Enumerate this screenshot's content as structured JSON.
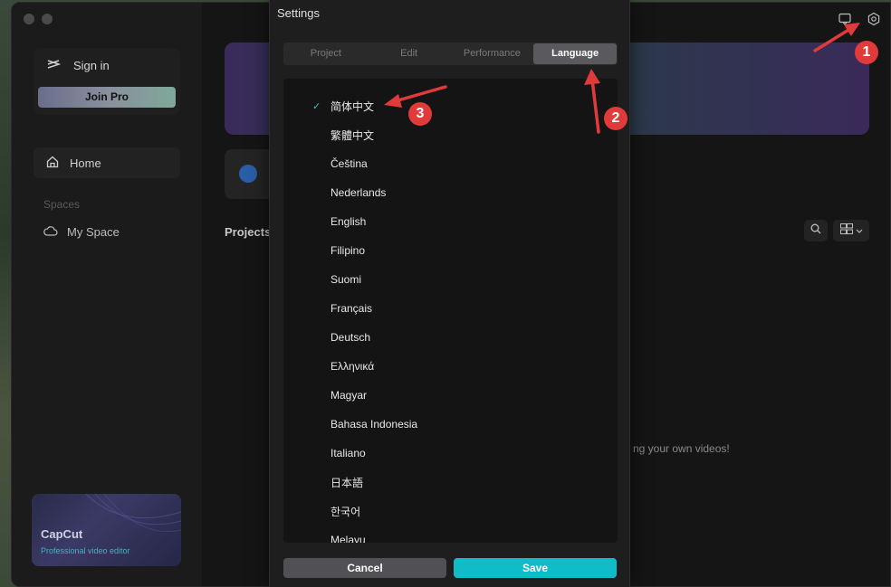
{
  "sidebar": {
    "sign_in_label": "Sign in",
    "join_pro_label": "Join Pro",
    "home_label": "Home",
    "spaces_label": "Spaces",
    "my_space_label": "My Space",
    "promo_title": "CapCut",
    "promo_subtitle": "Professional video editor"
  },
  "main": {
    "projects_label": "Projects",
    "empty_text": "ng your own videos!"
  },
  "dialog": {
    "title": "Settings",
    "tabs": [
      {
        "label": "Project",
        "active": false
      },
      {
        "label": "Edit",
        "active": false
      },
      {
        "label": "Performance",
        "active": false
      },
      {
        "label": "Language",
        "active": true
      }
    ],
    "selected_language": "简体中文",
    "check_glyph": "✓",
    "languages": [
      "简体中文",
      "繁體中文",
      "Čeština",
      "Nederlands",
      "English",
      "Filipino",
      "Suomi",
      "Français",
      "Deutsch",
      "Ελληνικά",
      "Magyar",
      "Bahasa Indonesia",
      "Italiano",
      "日本語",
      "한국어",
      "Melayu"
    ],
    "cancel_label": "Cancel",
    "save_label": "Save"
  },
  "annotations": {
    "callouts": [
      "1",
      "2",
      "3"
    ],
    "color": "#e03a3a"
  },
  "colors": {
    "accent": "#10bcc8",
    "check": "#3ac0c8"
  }
}
